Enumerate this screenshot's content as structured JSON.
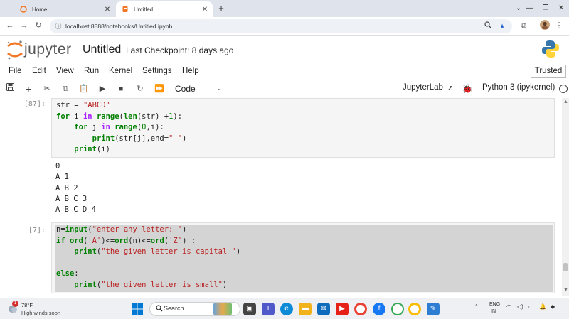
{
  "browser": {
    "tabs": [
      {
        "label": "Home",
        "active": false
      },
      {
        "label": "Untitled",
        "active": true
      }
    ],
    "url": "localhost:8888/notebooks/Untitled.ipynb"
  },
  "jupyter": {
    "logo_text": "jupyter",
    "notebook_title": "Untitled",
    "checkpoint": "Last Checkpoint: 8 days ago",
    "menu": [
      "File",
      "Edit",
      "View",
      "Run",
      "Kernel",
      "Settings",
      "Help"
    ],
    "trusted": "Trusted",
    "toolbar": {
      "cell_type": "Code",
      "jupyterlab_link": "JupyterLab",
      "kernel": "Python 3 (ipykernel)"
    }
  },
  "cells": [
    {
      "prompt": "[87]:",
      "code": [
        [
          {
            "t": "str = ",
            "c": ""
          },
          {
            "t": "\"ABCD\"",
            "c": "str"
          }
        ],
        [
          {
            "t": "for",
            "c": "kw"
          },
          {
            "t": " i ",
            "c": ""
          },
          {
            "t": "in",
            "c": "op"
          },
          {
            "t": " ",
            "c": ""
          },
          {
            "t": "range",
            "c": "kw"
          },
          {
            "t": "(",
            "c": ""
          },
          {
            "t": "len",
            "c": "kw"
          },
          {
            "t": "(str) +",
            "c": ""
          },
          {
            "t": "1",
            "c": "num"
          },
          {
            "t": "):",
            "c": ""
          }
        ],
        [
          {
            "t": "    ",
            "c": ""
          },
          {
            "t": "for",
            "c": "kw"
          },
          {
            "t": " j ",
            "c": ""
          },
          {
            "t": "in",
            "c": "op"
          },
          {
            "t": " ",
            "c": ""
          },
          {
            "t": "range",
            "c": "kw"
          },
          {
            "t": "(",
            "c": ""
          },
          {
            "t": "0",
            "c": "num"
          },
          {
            "t": ",i):",
            "c": ""
          }
        ],
        [
          {
            "t": "        ",
            "c": ""
          },
          {
            "t": "print",
            "c": "kw"
          },
          {
            "t": "(str[j],end=",
            "c": ""
          },
          {
            "t": "\" \"",
            "c": "str"
          },
          {
            "t": ")",
            "c": ""
          }
        ],
        [
          {
            "t": "    ",
            "c": ""
          },
          {
            "t": "print",
            "c": "kw"
          },
          {
            "t": "(i)",
            "c": ""
          }
        ]
      ],
      "output": [
        "0",
        "A 1",
        "A B 2",
        "A B C 3",
        "A B C D 4"
      ]
    },
    {
      "prompt": "[7]:",
      "code": [
        [
          {
            "t": "n=",
            "c": ""
          },
          {
            "t": "input",
            "c": "kw"
          },
          {
            "t": "(",
            "c": ""
          },
          {
            "t": "\"enter any letter: \"",
            "c": "str"
          },
          {
            "t": ")",
            "c": ""
          }
        ],
        [
          {
            "t": "if",
            "c": "kw"
          },
          {
            "t": " ",
            "c": ""
          },
          {
            "t": "ord",
            "c": "kw"
          },
          {
            "t": "(",
            "c": ""
          },
          {
            "t": "'A'",
            "c": "str"
          },
          {
            "t": ")<=",
            "c": ""
          },
          {
            "t": "ord",
            "c": "kw"
          },
          {
            "t": "(n)<=",
            "c": ""
          },
          {
            "t": "ord",
            "c": "kw"
          },
          {
            "t": "(",
            "c": ""
          },
          {
            "t": "'Z'",
            "c": "str"
          },
          {
            "t": ") :",
            "c": ""
          }
        ],
        [
          {
            "t": "    ",
            "c": ""
          },
          {
            "t": "print",
            "c": "kw"
          },
          {
            "t": "(",
            "c": ""
          },
          {
            "t": "\"the given letter is capital \"",
            "c": "str"
          },
          {
            "t": ")",
            "c": ""
          }
        ],
        [
          {
            "t": "",
            "c": ""
          }
        ],
        [
          {
            "t": "else",
            "c": "kw"
          },
          {
            "t": ":",
            "c": ""
          }
        ],
        [
          {
            "t": "    ",
            "c": ""
          },
          {
            "t": "print",
            "c": "kw"
          },
          {
            "t": "(",
            "c": ""
          },
          {
            "t": "\"the given letter is small\"",
            "c": "str"
          },
          {
            "t": ")",
            "c": ""
          }
        ]
      ]
    }
  ],
  "taskbar": {
    "weather_temp": "78°F",
    "weather_desc": "High winds soon",
    "notification_count": "1",
    "search_placeholder": "Search",
    "lang_top": "ENG",
    "lang_bottom": "IN"
  },
  "colors": {
    "jupyter_orange": "#f37726",
    "keyword": "#008000",
    "string": "#ba2121",
    "operator": "#aa22ff",
    "selected_cell": "#d4d4d4"
  }
}
